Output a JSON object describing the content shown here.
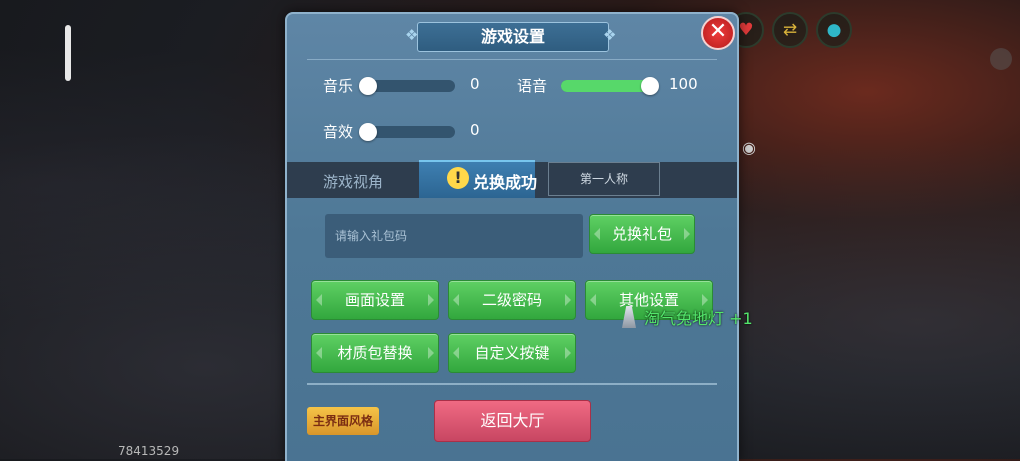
{
  "panel": {
    "title": "游戏设置",
    "close_icon": "close-x-icon"
  },
  "audio": {
    "music": {
      "label": "音乐",
      "value": "0",
      "level": 0
    },
    "voice": {
      "label": "语音",
      "value": "100",
      "level": 1
    },
    "sfx": {
      "label": "音效",
      "value": "0",
      "level": 0
    }
  },
  "view": {
    "label": "游戏视角",
    "inactive_tab": "第一人称"
  },
  "toast": {
    "icon": "exclamation-icon",
    "text": "兑换成功"
  },
  "gift": {
    "placeholder": "请输入礼包码",
    "button": "兑换礼包"
  },
  "menu": {
    "graphics": "画面设置",
    "second_password": "二级密码",
    "other_settings": "其他设置",
    "texture_pack": "材质包替换",
    "custom_keys": "自定义按键"
  },
  "footer": {
    "main_style": "主界面风格",
    "back_lobby": "返回大厅"
  },
  "hud": {
    "player_id": "78413529",
    "pickup_text": "淘气兔地灯 +1",
    "icons": [
      "heart-icon",
      "swap-icon",
      "water-drop-icon"
    ]
  },
  "colors": {
    "accent_green": "#57d86a",
    "panel_blue": "#4e7896",
    "back_pink": "#dc5571",
    "style_gold": "#e9ad3a"
  }
}
